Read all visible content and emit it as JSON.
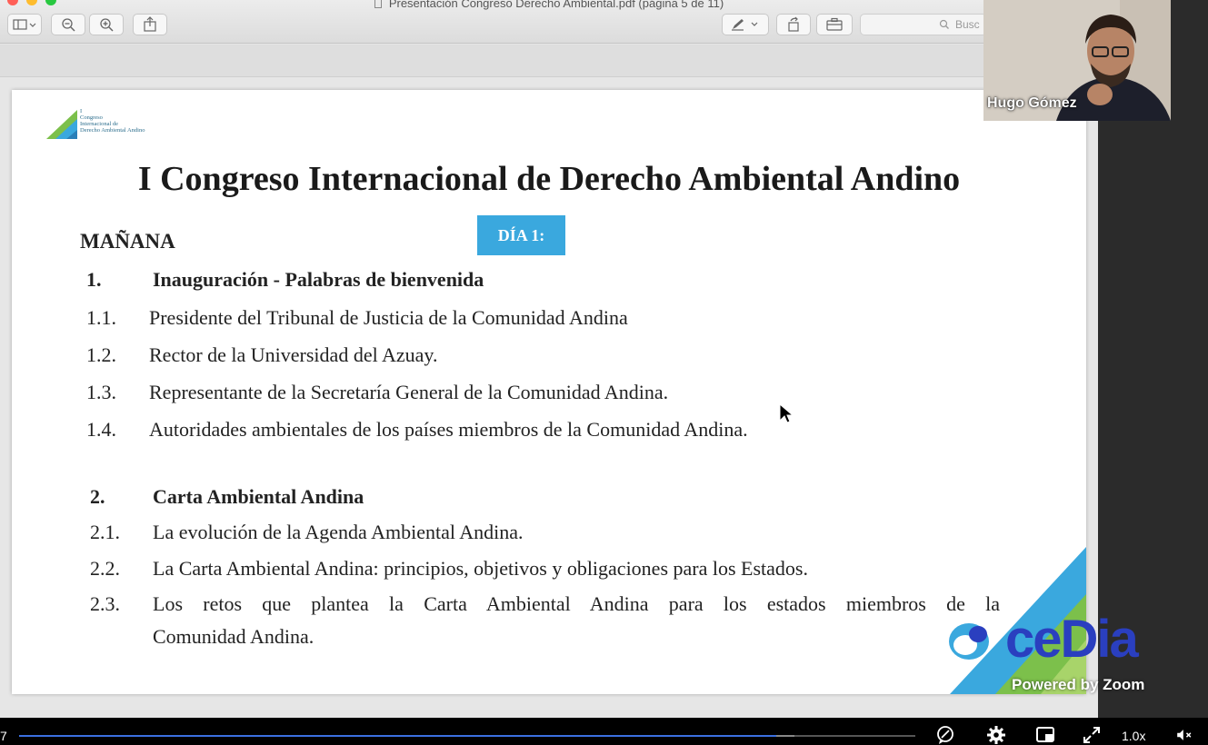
{
  "window": {
    "title": "Presentación Congreso Derecho Ambiental.pdf (página 5 de 11)",
    "search_placeholder": "Busc"
  },
  "slide": {
    "logo_text": [
      "I",
      "Congreso",
      "Internacional de",
      "Derecho Ambiental Andino"
    ],
    "title": "I Congreso Internacional de Derecho Ambiental Andino",
    "day_badge": "DÍA 1:",
    "session": "MAÑANA",
    "sections": [
      {
        "number": "1.",
        "heading": "Inauguración - Palabras de bienvenida",
        "items": [
          {
            "number": "1.1.",
            "text": "Presidente del Tribunal de Justicia de la Comunidad Andina"
          },
          {
            "number": "1.2.",
            "text": "Rector de la Universidad del Azuay."
          },
          {
            "number": "1.3.",
            "text": "Representante de la Secretaría General de la Comunidad Andina."
          },
          {
            "number": "1.4.",
            "text": "Autoridades ambientales de los países miembros de la Comunidad Andina."
          }
        ]
      },
      {
        "number": "2.",
        "heading": "Carta Ambiental Andina",
        "items": [
          {
            "number": "2.1.",
            "text": "La evolución de la Agenda Ambiental Andina."
          },
          {
            "number": "2.2.",
            "text": "La Carta Ambiental Andina: principios, objetivos y obligaciones para los Estados."
          },
          {
            "number": "2.3.",
            "text": "Los retos que plantea la Carta Ambiental Andina para los estados miembros de la",
            "text2": "Comunidad Andina."
          }
        ]
      }
    ]
  },
  "webcam": {
    "participant_name": "Hugo Gómez"
  },
  "branding": {
    "cedia": "ceDia",
    "powered_by": "Powered by Zoom"
  },
  "player": {
    "time_fragment": "7",
    "progress": 0.845,
    "buffered": 0.865,
    "speed": "1.0x"
  },
  "colors": {
    "accent_blue": "#3aa8de",
    "cedia_blue": "#2a3fbf",
    "slide_green": "#7cc04b",
    "progress": "#3b6fe0"
  }
}
